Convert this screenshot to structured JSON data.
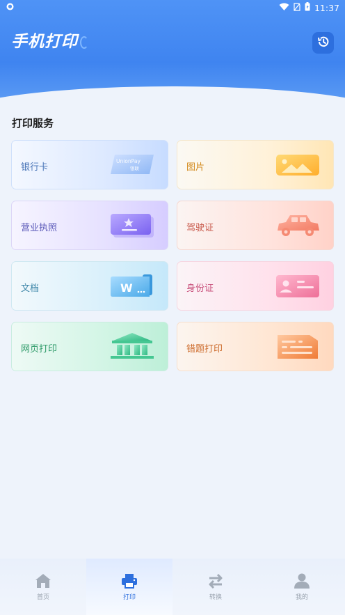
{
  "status_bar": {
    "time": "11:37"
  },
  "header": {
    "title": "手机打印"
  },
  "section": {
    "title": "打印服务"
  },
  "services": [
    {
      "label": "银行卡",
      "art_text_1": "UnionPay",
      "art_text_2": "银联"
    },
    {
      "label": "图片"
    },
    {
      "label": "营业执照"
    },
    {
      "label": "驾驶证"
    },
    {
      "label": "文档",
      "art_text_1": "W"
    },
    {
      "label": "身份证"
    },
    {
      "label": "网页打印"
    },
    {
      "label": "错题打印"
    }
  ],
  "nav": [
    {
      "label": "首页",
      "icon": "home-icon"
    },
    {
      "label": "打印",
      "icon": "printer-icon"
    },
    {
      "label": "转换",
      "icon": "convert-icon"
    },
    {
      "label": "我的",
      "icon": "user-icon"
    }
  ],
  "colors": {
    "primary": "#3f84f0",
    "active_nav": "#2d6fde",
    "inactive_nav": "#9aa3af"
  }
}
